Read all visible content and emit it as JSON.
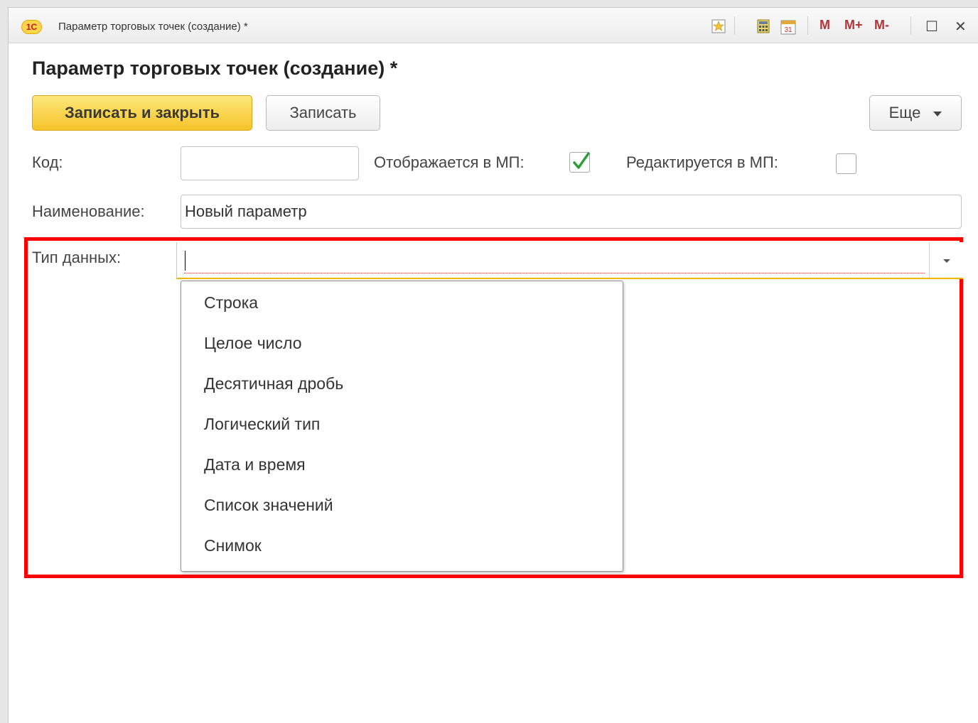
{
  "window": {
    "app_badge": "1С",
    "title": "Параметр торговых точек (создание) *",
    "toolbar": {
      "icons": [
        "favorites-star-icon",
        "calculator-icon",
        "calendar-icon"
      ],
      "calendar_day": "31",
      "memory_buttons": [
        "M",
        "M+",
        "M-"
      ],
      "maximize_glyph": "☐",
      "close_glyph": "✕"
    }
  },
  "form": {
    "title": "Параметр торговых точек (создание) *",
    "buttons": {
      "save_close": "Записать и закрыть",
      "save": "Записать",
      "more": "Еще"
    },
    "fields": {
      "code_label": "Код:",
      "code_value": "",
      "shown_label": "Отображается в МП:",
      "shown_checked": true,
      "editable_label": "Редактируется в МП:",
      "editable_checked": false,
      "name_label": "Наименование:",
      "name_value": "Новый параметр",
      "datatype_label": "Тип данных:",
      "datatype_value": ""
    },
    "datatype_options": [
      "Строка",
      "Целое число",
      "Десятичная дробь",
      "Логический тип",
      "Дата и время",
      "Список значений",
      "Снимок"
    ]
  },
  "colors": {
    "primary_button": "#f6c42a",
    "highlight": "#ff0000",
    "focus_underline": "#f2b600",
    "checkmark": "#2f9e3a",
    "memory_buttons": "#b2353b"
  }
}
